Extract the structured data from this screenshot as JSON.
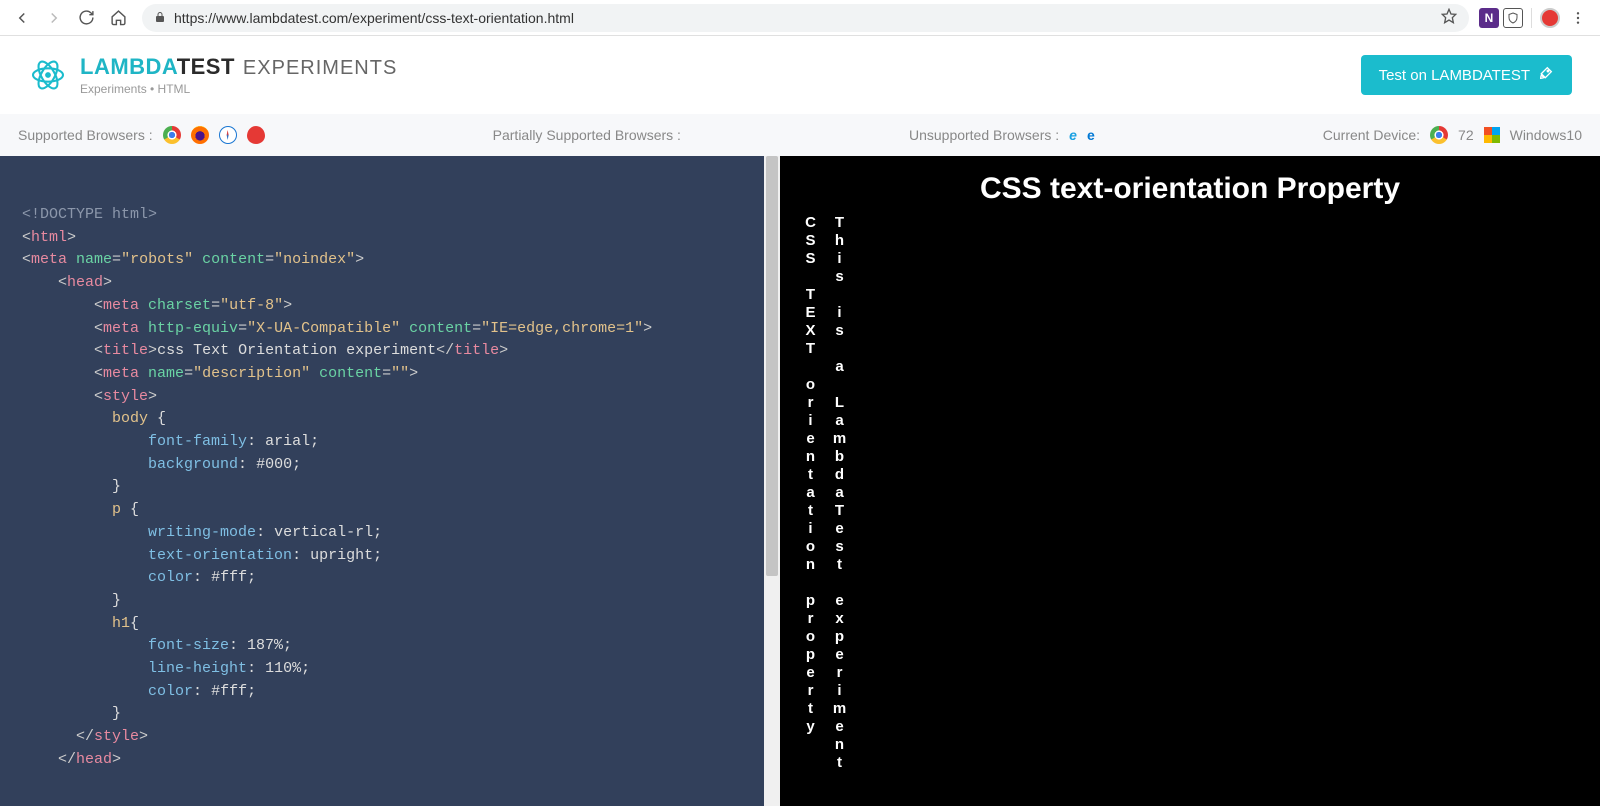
{
  "chrome": {
    "url_display": "https://www.lambdatest.com/experiment/css-text-orientation.html"
  },
  "header": {
    "brand_teal": "LAMBDA",
    "brand_dark": "TEST",
    "brand_sub": "EXPERIMENTS",
    "breadcrumb": "Experiments • HTML",
    "cta": "Test on LAMBDATEST"
  },
  "support": {
    "supported_label": "Supported Browsers :",
    "partial_label": "Partially Supported Browsers :",
    "unsupported_label": "Unsupported Browsers :",
    "device_label": "Current Device:",
    "device_browser_version": "72",
    "device_os": "Windows10"
  },
  "code_tokens": [
    [
      {
        "c": "t-doc",
        "t": "<!DOCTYPE html>"
      }
    ],
    [
      {
        "c": "t-ang",
        "t": "<"
      },
      {
        "c": "t-tag",
        "t": "html"
      },
      {
        "c": "t-ang",
        "t": ">"
      }
    ],
    [
      {
        "c": "t-ang",
        "t": "<"
      },
      {
        "c": "t-tag",
        "t": "meta "
      },
      {
        "c": "t-attr",
        "t": "name"
      },
      {
        "c": "t-ang",
        "t": "="
      },
      {
        "c": "t-str",
        "t": "\"robots\""
      },
      {
        "c": "t-attr",
        "t": " content"
      },
      {
        "c": "t-ang",
        "t": "="
      },
      {
        "c": "t-str",
        "t": "\"noindex\""
      },
      {
        "c": "t-ang",
        "t": ">"
      }
    ],
    [
      {
        "c": "",
        "t": "    "
      },
      {
        "c": "t-ang",
        "t": "<"
      },
      {
        "c": "t-tag",
        "t": "head"
      },
      {
        "c": "t-ang",
        "t": ">"
      }
    ],
    [
      {
        "c": "",
        "t": "        "
      },
      {
        "c": "t-ang",
        "t": "<"
      },
      {
        "c": "t-tag",
        "t": "meta "
      },
      {
        "c": "t-attr",
        "t": "charset"
      },
      {
        "c": "t-ang",
        "t": "="
      },
      {
        "c": "t-str",
        "t": "\"utf-8\""
      },
      {
        "c": "t-ang",
        "t": ">"
      }
    ],
    [
      {
        "c": "",
        "t": "        "
      },
      {
        "c": "t-ang",
        "t": "<"
      },
      {
        "c": "t-tag",
        "t": "meta "
      },
      {
        "c": "t-attr",
        "t": "http-equiv"
      },
      {
        "c": "t-ang",
        "t": "="
      },
      {
        "c": "t-str",
        "t": "\"X-UA-Compatible\""
      },
      {
        "c": "t-attr",
        "t": " content"
      },
      {
        "c": "t-ang",
        "t": "="
      },
      {
        "c": "t-str",
        "t": "\"IE=edge,chrome=1\""
      },
      {
        "c": "t-ang",
        "t": ">"
      }
    ],
    [
      {
        "c": "",
        "t": "        "
      },
      {
        "c": "t-ang",
        "t": "<"
      },
      {
        "c": "t-tag",
        "t": "title"
      },
      {
        "c": "t-ang",
        "t": ">"
      },
      {
        "c": "t-val",
        "t": "css Text Orientation experiment"
      },
      {
        "c": "t-ang",
        "t": "</"
      },
      {
        "c": "t-tag",
        "t": "title"
      },
      {
        "c": "t-ang",
        "t": ">"
      }
    ],
    [
      {
        "c": "",
        "t": "        "
      },
      {
        "c": "t-ang",
        "t": "<"
      },
      {
        "c": "t-tag",
        "t": "meta "
      },
      {
        "c": "t-attr",
        "t": "name"
      },
      {
        "c": "t-ang",
        "t": "="
      },
      {
        "c": "t-str",
        "t": "\"description\""
      },
      {
        "c": "t-attr",
        "t": " content"
      },
      {
        "c": "t-ang",
        "t": "="
      },
      {
        "c": "t-str",
        "t": "\"\""
      },
      {
        "c": "t-ang",
        "t": ">"
      }
    ],
    [
      {
        "c": "",
        "t": "        "
      },
      {
        "c": "t-ang",
        "t": "<"
      },
      {
        "c": "t-tag",
        "t": "style"
      },
      {
        "c": "t-ang",
        "t": ">"
      }
    ],
    [
      {
        "c": "",
        "t": "          "
      },
      {
        "c": "t-sel",
        "t": "body"
      },
      {
        "c": "t-val",
        "t": " {"
      }
    ],
    [
      {
        "c": "",
        "t": "              "
      },
      {
        "c": "t-prop",
        "t": "font-family"
      },
      {
        "c": "t-val",
        "t": ": arial;"
      }
    ],
    [
      {
        "c": "",
        "t": "              "
      },
      {
        "c": "t-prop",
        "t": "background"
      },
      {
        "c": "t-val",
        "t": ": "
      },
      {
        "c": "t-hex",
        "t": "#000"
      },
      {
        "c": "t-val",
        "t": ";"
      }
    ],
    [
      {
        "c": "",
        "t": "          "
      },
      {
        "c": "t-val",
        "t": "}"
      }
    ],
    [
      {
        "c": "",
        "t": "          "
      },
      {
        "c": "t-sel",
        "t": "p"
      },
      {
        "c": "t-val",
        "t": " {"
      }
    ],
    [
      {
        "c": "",
        "t": "              "
      },
      {
        "c": "t-prop",
        "t": "writing-mode"
      },
      {
        "c": "t-val",
        "t": ": vertical-rl;"
      }
    ],
    [
      {
        "c": "",
        "t": "              "
      },
      {
        "c": "t-prop",
        "t": "text-orientation"
      },
      {
        "c": "t-val",
        "t": ": upright;"
      }
    ],
    [
      {
        "c": "",
        "t": "              "
      },
      {
        "c": "t-prop",
        "t": "color"
      },
      {
        "c": "t-val",
        "t": ": "
      },
      {
        "c": "t-hex",
        "t": "#fff"
      },
      {
        "c": "t-val",
        "t": ";"
      }
    ],
    [
      {
        "c": "",
        "t": "          "
      },
      {
        "c": "t-val",
        "t": "}"
      }
    ],
    [
      {
        "c": "",
        "t": "          "
      },
      {
        "c": "t-sel",
        "t": "h1"
      },
      {
        "c": "t-val",
        "t": "{"
      }
    ],
    [
      {
        "c": "",
        "t": "              "
      },
      {
        "c": "t-prop",
        "t": "font-size"
      },
      {
        "c": "t-val",
        "t": ": 187%;"
      }
    ],
    [
      {
        "c": "",
        "t": "              "
      },
      {
        "c": "t-prop",
        "t": "line-height"
      },
      {
        "c": "t-val",
        "t": ": 110%;"
      }
    ],
    [
      {
        "c": "",
        "t": "              "
      },
      {
        "c": "t-prop",
        "t": "color"
      },
      {
        "c": "t-val",
        "t": ": "
      },
      {
        "c": "t-hex",
        "t": "#fff"
      },
      {
        "c": "t-val",
        "t": ";"
      }
    ],
    [
      {
        "c": "",
        "t": "          "
      },
      {
        "c": "t-val",
        "t": "}"
      }
    ],
    [
      {
        "c": "",
        "t": "      "
      },
      {
        "c": "t-ang",
        "t": "</"
      },
      {
        "c": "t-tag",
        "t": "style"
      },
      {
        "c": "t-ang",
        "t": ">"
      }
    ],
    [
      {
        "c": "",
        "t": "    "
      },
      {
        "c": "t-ang",
        "t": "</"
      },
      {
        "c": "t-tag",
        "t": "head"
      },
      {
        "c": "t-ang",
        "t": ">"
      }
    ]
  ],
  "preview": {
    "title": "CSS text-orientation Property",
    "col1": "CSS TEXT orientation property",
    "col2": "This is a LambdaTest experiment"
  }
}
